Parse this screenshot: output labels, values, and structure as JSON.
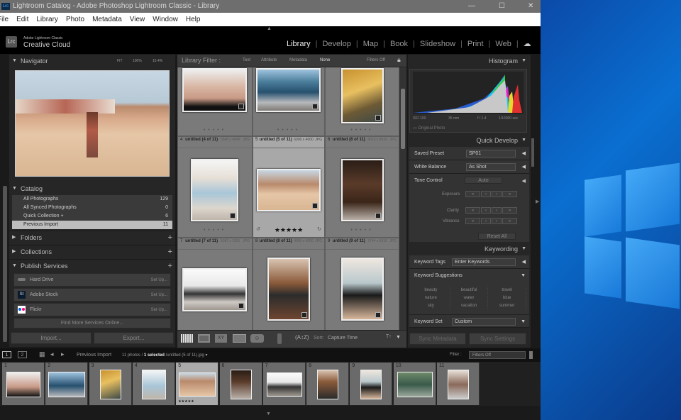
{
  "window": {
    "title": "Lightroom Catalog - Adobe Photoshop Lightroom Classic - Library",
    "app_icon": "Lrc"
  },
  "menu": [
    "File",
    "Edit",
    "Library",
    "Photo",
    "Metadata",
    "View",
    "Window",
    "Help"
  ],
  "brand": {
    "line1": "Adobe Lightroom Classic",
    "line2": "Creative Cloud",
    "logo": "Lrc"
  },
  "modules": [
    "Library",
    "Develop",
    "Map",
    "Book",
    "Slideshow",
    "Print",
    "Web"
  ],
  "active_module": "Library",
  "navigator": {
    "title": "Navigator",
    "zoom_options": [
      "FIT",
      "100%",
      "15.4%"
    ]
  },
  "catalog": {
    "title": "Catalog",
    "items": [
      {
        "label": "All Photographs",
        "count": "129"
      },
      {
        "label": "All Synced Photographs",
        "count": "0"
      },
      {
        "label": "Quick Collection +",
        "count": "6"
      },
      {
        "label": "Previous Import",
        "count": "11"
      }
    ]
  },
  "folders": {
    "title": "Folders"
  },
  "collections": {
    "title": "Collections"
  },
  "publish": {
    "title": "Publish Services",
    "services": [
      {
        "label": "Hard Drive",
        "action": "Set Up..."
      },
      {
        "label": "Adobe Stock",
        "icon": "St",
        "action": "Set Up..."
      },
      {
        "label": "Flickr",
        "action": "Set Up..."
      }
    ],
    "find_more": "Find More Services Online..."
  },
  "left_buttons": {
    "import": "Import...",
    "export": "Export..."
  },
  "filter": {
    "label": "Library Filter :",
    "tabs": [
      "Text",
      "Attribute",
      "Metadata",
      "None"
    ],
    "active": "None",
    "preset": "Filters Off"
  },
  "grid": {
    "cells": [
      {
        "num": "4",
        "name": "untitled (4 of 11)",
        "dims": "3648 x 4849",
        "type": "JPG"
      },
      {
        "num": "5",
        "name": "untitled (5 of 11)",
        "dims": "6000 x 4000",
        "type": "JPG",
        "rating": "★★★★★"
      },
      {
        "num": "6",
        "name": "untitled (6 of 11)",
        "dims": "4016 x 6016",
        "type": "JPG"
      },
      {
        "num": "7",
        "name": "untitled (7 of 11)",
        "dims": "5087 x 3391",
        "type": "JPG"
      },
      {
        "num": "8",
        "name": "untitled (8 of 11)",
        "dims": "4000 x 6000",
        "type": "JPG"
      },
      {
        "num": "9",
        "name": "untitled (9 of 11)",
        "dims": "3744 x 5616",
        "type": "JPG"
      }
    ]
  },
  "toolbar": {
    "sort_label": "Sort:",
    "sort_value": "Capture Time"
  },
  "histogram": {
    "title": "Histogram",
    "iso": "ISO 100",
    "focal": "35 mm",
    "aperture": "f / 1.4",
    "shutter": "1/16000 sec",
    "original_photo": "Original Photo"
  },
  "quick_develop": {
    "title": "Quick Develop",
    "saved_preset_label": "Saved Preset",
    "saved_preset": "SP01",
    "wb_label": "White Balance",
    "wb": "As Shot",
    "tone_label": "Tone Control",
    "auto": "Auto",
    "exposure": "Exposure",
    "clarity": "Clarity",
    "vibrance": "Vibrance",
    "reset": "Reset All"
  },
  "keywording": {
    "title": "Keywording",
    "tags_label": "Keyword Tags",
    "tags_placeholder": "Enter Keywords",
    "suggestions_label": "Keyword Suggestions",
    "suggestions": [
      "beauty",
      "beautiful",
      "travel",
      "nature",
      "water",
      "blue",
      "sky",
      "vacation",
      "summer"
    ],
    "set_label": "Keyword Set",
    "set_value": "Custom"
  },
  "right_buttons": {
    "sync_metadata": "Sync Metadata",
    "sync_settings": "Sync Settings"
  },
  "filmstrip_bar": {
    "pages": [
      "1",
      "2"
    ],
    "source": "Previous Import",
    "count": "11 photos /",
    "selected": "1 selected",
    "file": "/untitled (5 of 11).jpg",
    "filter_label": "Filter :",
    "filter_value": "Filters Off"
  },
  "filmstrip": [
    "1",
    "2",
    "3",
    "4",
    "5",
    "6",
    "7",
    "8",
    "9",
    "10",
    "11"
  ],
  "colors": {
    "accent_bg": "#262626",
    "selected_cell": "#a8a8a8",
    "desktop": "#0a5fc0"
  }
}
